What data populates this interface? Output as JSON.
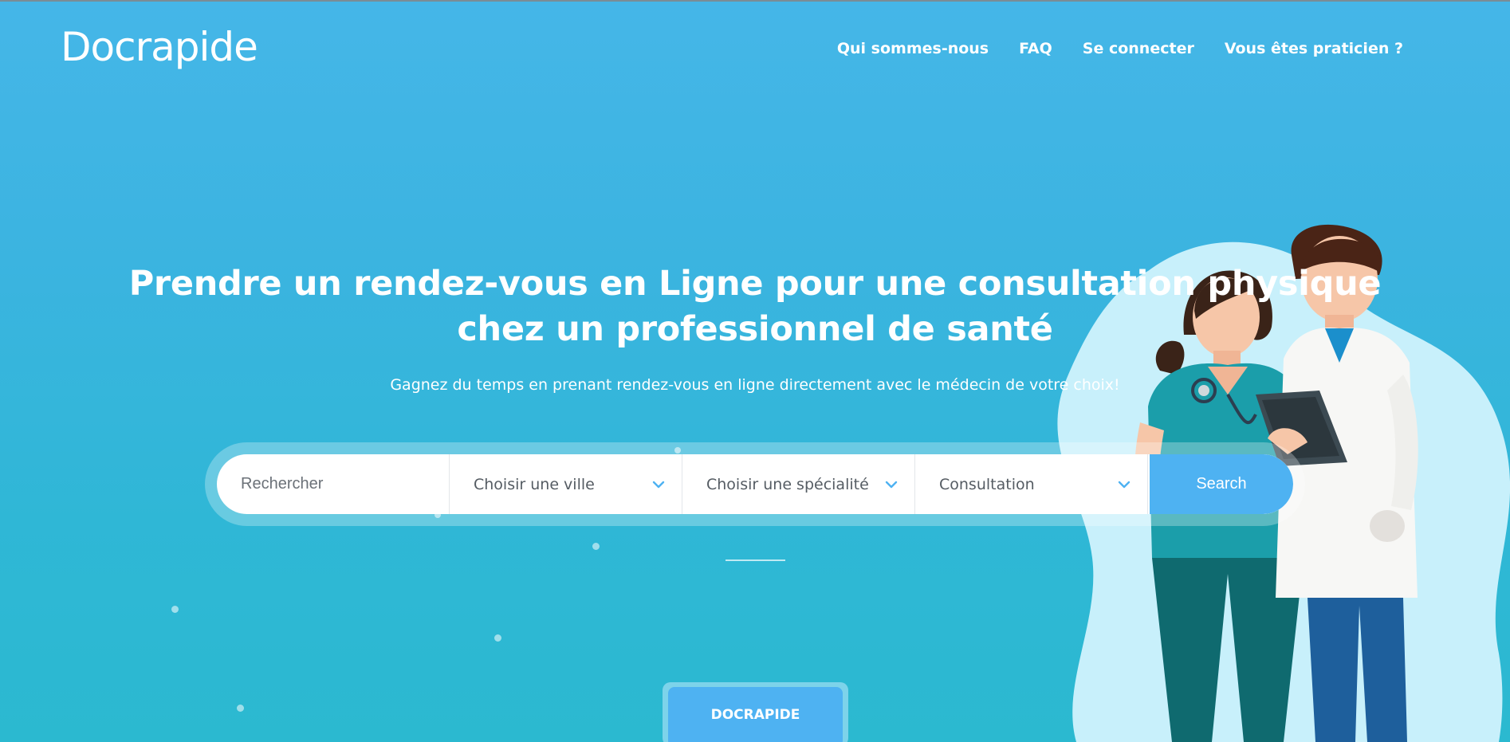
{
  "brand": {
    "logo": "Docrapide"
  },
  "nav": {
    "items": [
      {
        "label": "Qui sommes-nous"
      },
      {
        "label": "FAQ"
      },
      {
        "label": "Se connecter"
      },
      {
        "label": "Vous êtes praticien ?"
      }
    ]
  },
  "hero": {
    "title": "Prendre un rendez-vous en Ligne pour une consultation physique chez un professionnel de santé",
    "subtitle": "Gagnez du temps en prenant rendez-vous en ligne directement avec le médecin de votre choix!"
  },
  "search": {
    "placeholder": "Rechercher",
    "city_select": "Choisir une ville",
    "specialty_select": "Choisir une spécialité",
    "type_select": "Consultation",
    "button": "Search"
  },
  "footer_tab": {
    "label": "DOCRAPIDE"
  },
  "colors": {
    "accent": "#4eb2f2",
    "background_top": "#45b6e8",
    "background_bottom": "#2bb9d0"
  },
  "icons": [
    "chevron-down-icon"
  ]
}
